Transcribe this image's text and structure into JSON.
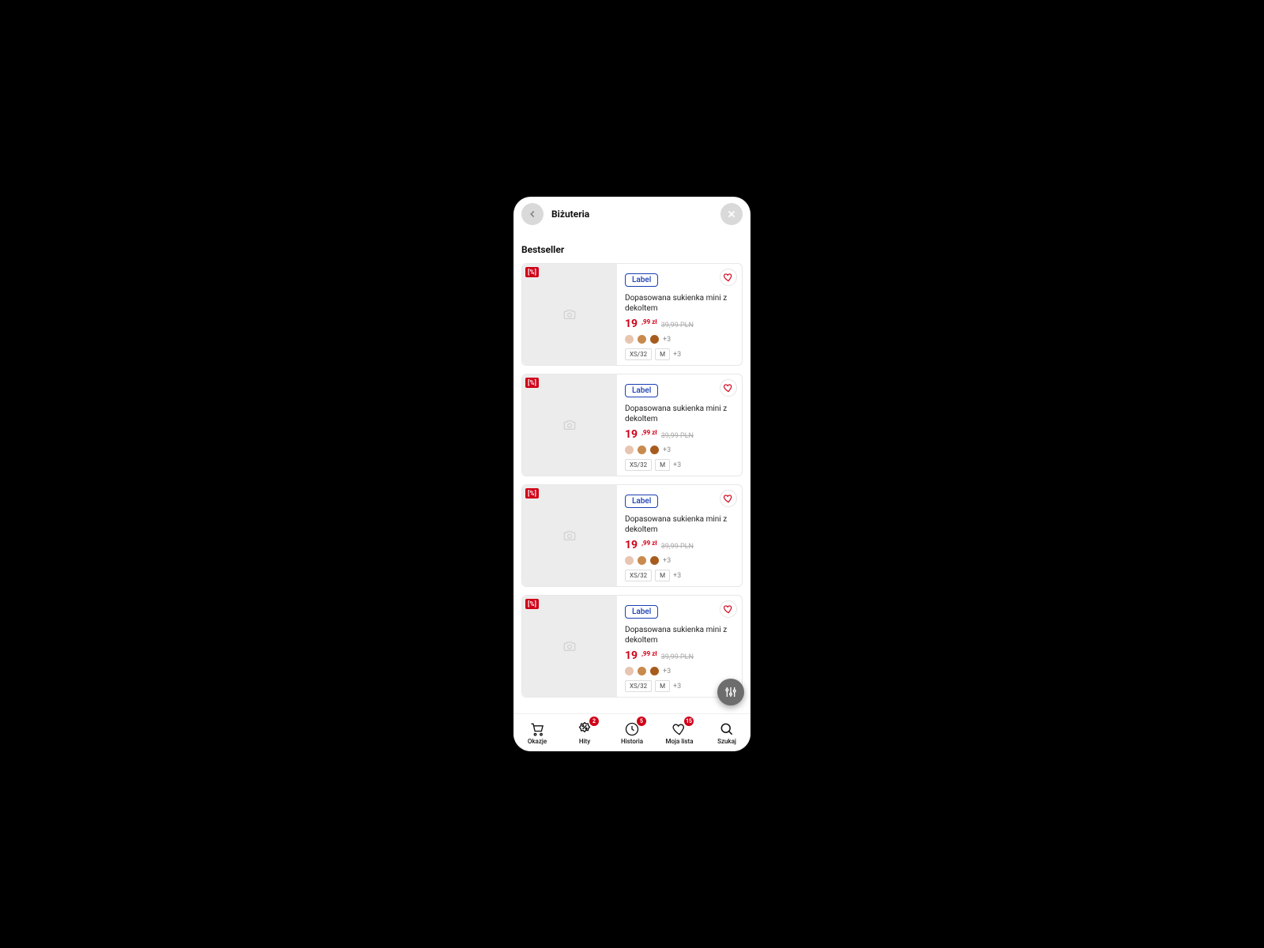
{
  "header": {
    "title": "Biżuteria"
  },
  "section": {
    "title": "Bestseller"
  },
  "colors": {
    "accent_red": "#d00018",
    "label_blue": "#1a3fb3",
    "swatch1": "#e8c5b0",
    "swatch2": "#c98a4e",
    "swatch3": "#a75c1e"
  },
  "products": [
    {
      "sale_badge": "[%]",
      "label": "Label",
      "title": "Dopasowana sukienka mini z dekoltem",
      "price_main": "19",
      "price_sub": ",99 zł",
      "price_old": "39,99 PLN",
      "swatch_more": "+3",
      "sizes": [
        "XS/32",
        "M"
      ],
      "size_more": "+3"
    },
    {
      "sale_badge": "[%]",
      "label": "Label",
      "title": "Dopasowana sukienka mini z dekoltem",
      "price_main": "19",
      "price_sub": ",99 zł",
      "price_old": "39,99 PLN",
      "swatch_more": "+3",
      "sizes": [
        "XS/32",
        "M"
      ],
      "size_more": "+3"
    },
    {
      "sale_badge": "[%]",
      "label": "Label",
      "title": "Dopasowana sukienka mini z dekoltem",
      "price_main": "19",
      "price_sub": ",99 zł",
      "price_old": "39,99 PLN",
      "swatch_more": "+3",
      "sizes": [
        "XS/32",
        "M"
      ],
      "size_more": "+3"
    },
    {
      "sale_badge": "[%]",
      "label": "Label",
      "title": "Dopasowana sukienka mini z dekoltem",
      "price_main": "19",
      "price_sub": ",99 zł",
      "price_old": "39,99 PLN",
      "swatch_more": "+3",
      "sizes": [
        "XS/32",
        "M"
      ],
      "size_more": "+3"
    }
  ],
  "bottom_nav": [
    {
      "label": "Okazje",
      "badge": null
    },
    {
      "label": "Hity",
      "badge": "2"
    },
    {
      "label": "Historia",
      "badge": "5"
    },
    {
      "label": "Moja lista",
      "badge": "15"
    },
    {
      "label": "Szukaj",
      "badge": null
    }
  ]
}
